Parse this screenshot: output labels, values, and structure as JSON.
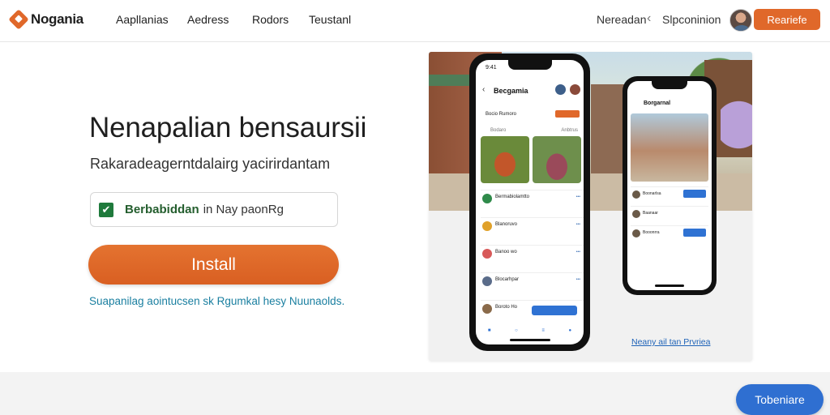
{
  "header": {
    "brand": "Nogania",
    "nav": [
      "Aapllanias",
      "Aedress",
      "Rodors",
      "Teustanl"
    ],
    "right_link_1": "Nereadan",
    "right_link_2": "Slpconinion",
    "cta_label": "Reariefe"
  },
  "hero": {
    "title": "Nenapalian bensaursii",
    "subtitle": "Rakaradeagerntdalairg yacirirdantam",
    "checkbox": {
      "checked": true,
      "strong_text": "Berbabiddan",
      "rest_text": "in Nay paonRg"
    },
    "install_label": "Install",
    "link_text": "Suapanilag aointucsen sk Rgumkal hesy Nuunaolds."
  },
  "image": {
    "phone1": {
      "title": "Becgamia",
      "filter_label": "Bocio Rumoro",
      "tabs": [
        "Bodaro",
        "Anbtrus"
      ],
      "items": [
        "Bermabiolamtto",
        "Blanoruvo",
        "Banoo wo",
        "Blocarhpar",
        "Boroto Ho"
      ]
    },
    "phone2": {
      "title": "Borgarnal",
      "items": [
        "Boonarlsa",
        "Baanaar",
        "Booonrra"
      ]
    },
    "caption": "Neany ail tan Prvriea"
  },
  "floating_button": {
    "label": "Tobeniare"
  },
  "colors": {
    "accent_orange": "#e0682a",
    "accent_blue": "#2f6fd1",
    "check_green": "#1f7a3c",
    "link_teal": "#1a7fa0"
  }
}
